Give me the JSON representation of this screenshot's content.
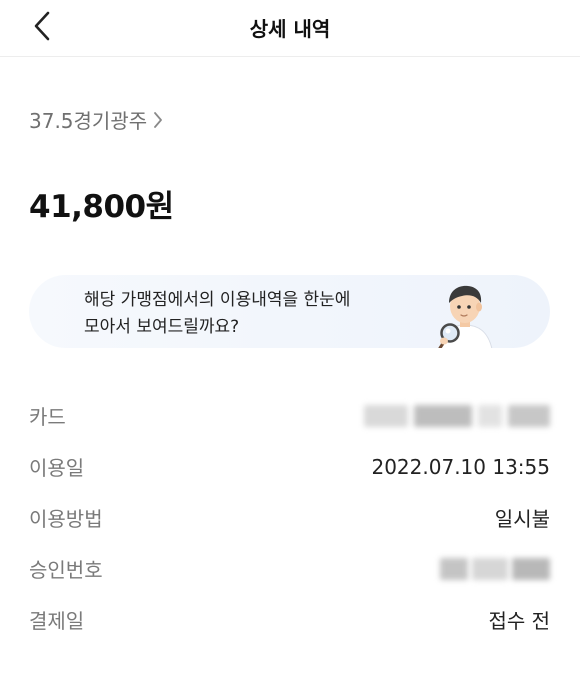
{
  "header": {
    "title": "상세 내역",
    "back_icon": "chevron-left-icon"
  },
  "merchant": {
    "name": "37.5경기광주",
    "chevron_icon": "chevron-right-icon"
  },
  "amount": "41,800원",
  "banner": {
    "line1": "해당 가맹점에서의 이용내역을 한눈에",
    "line2": "모아서 보여드릴까요?",
    "illustration": "person-with-magnifier-illustration"
  },
  "details": [
    {
      "label": "카드",
      "value": "",
      "redacted": true
    },
    {
      "label": "이용일",
      "value": "2022.07.10 13:55",
      "redacted": false
    },
    {
      "label": "이용방법",
      "value": "일시불",
      "redacted": false
    },
    {
      "label": "승인번호",
      "value": "",
      "redacted": true
    },
    {
      "label": "결제일",
      "value": "접수 전",
      "redacted": false
    }
  ],
  "colors": {
    "banner_bg": "#eef3fb",
    "label_gray": "#7a7a7a",
    "divider": "#ededed"
  }
}
